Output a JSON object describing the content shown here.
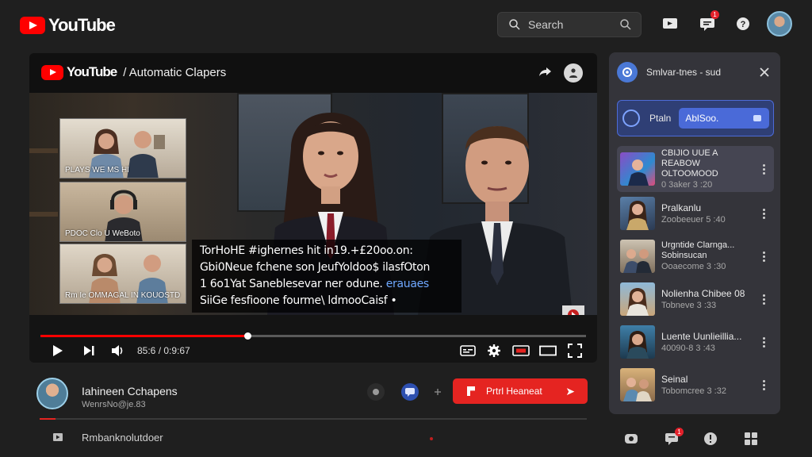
{
  "header": {
    "logo_text": "YouTube",
    "search_placeholder": "Search",
    "notification_count": "1",
    "icons": [
      "create-icon",
      "notifications-icon",
      "help-icon",
      "account-avatar"
    ]
  },
  "player": {
    "brand": "YouTube",
    "title": "/ Automatic Clapers",
    "participants": [
      {
        "label": "PLAYS WE MS HI"
      },
      {
        "label": "PDOC Clo U WeBoto"
      },
      {
        "label": "Rm Ie OMMAGAL  IN KOUOSTD"
      }
    ],
    "captions": [
      "TorHoHE #ighernes hit in19.+£20oo.on:",
      "Gbi0Neue fchene son JeufYoldoo$ ilasfOton",
      "1 6o1Yat Saneblesevar ner odune. ",
      "SiiGe fesfioone fourme\\ ldmooCaisf •"
    ],
    "caption_highlight": "erauaes",
    "progress_fraction": 0.38,
    "time": "85:6 / 0:9:67",
    "colors": {
      "accent": "#ff0000",
      "caption_highlight": "#6fa8ff"
    }
  },
  "channel": {
    "name": "Iahineen Cchapens",
    "subscribers": "WenrsNo@je.83",
    "action_button": "Prtrl Heaneat",
    "bottom_label": "Rmbanknolutdoer"
  },
  "panel": {
    "title": "Smlvar-tnes - sud",
    "filter_label": "Ptaln",
    "filter_value": "AblSoo.",
    "items": [
      {
        "title": "CBIJIO UUE A REABOW",
        "subtitle": "OLTOOMOOD",
        "meta": "0 3aker 3 :20"
      },
      {
        "title": "Pralkanlu",
        "meta": "Zoobeeuer 5 :40"
      },
      {
        "title": "Urgntide Clarnga...",
        "subtitle": "Sobinsucan",
        "meta": "Ooaecome 3 :30"
      },
      {
        "title": "Nolienha Chibee 08",
        "meta": "Tobneve 3 :33"
      },
      {
        "title": "Luente Uunlieillia...",
        "meta": "40090-8 3 :43"
      },
      {
        "title": "Seinal",
        "meta": "Tobomcree 3 :32"
      }
    ]
  }
}
